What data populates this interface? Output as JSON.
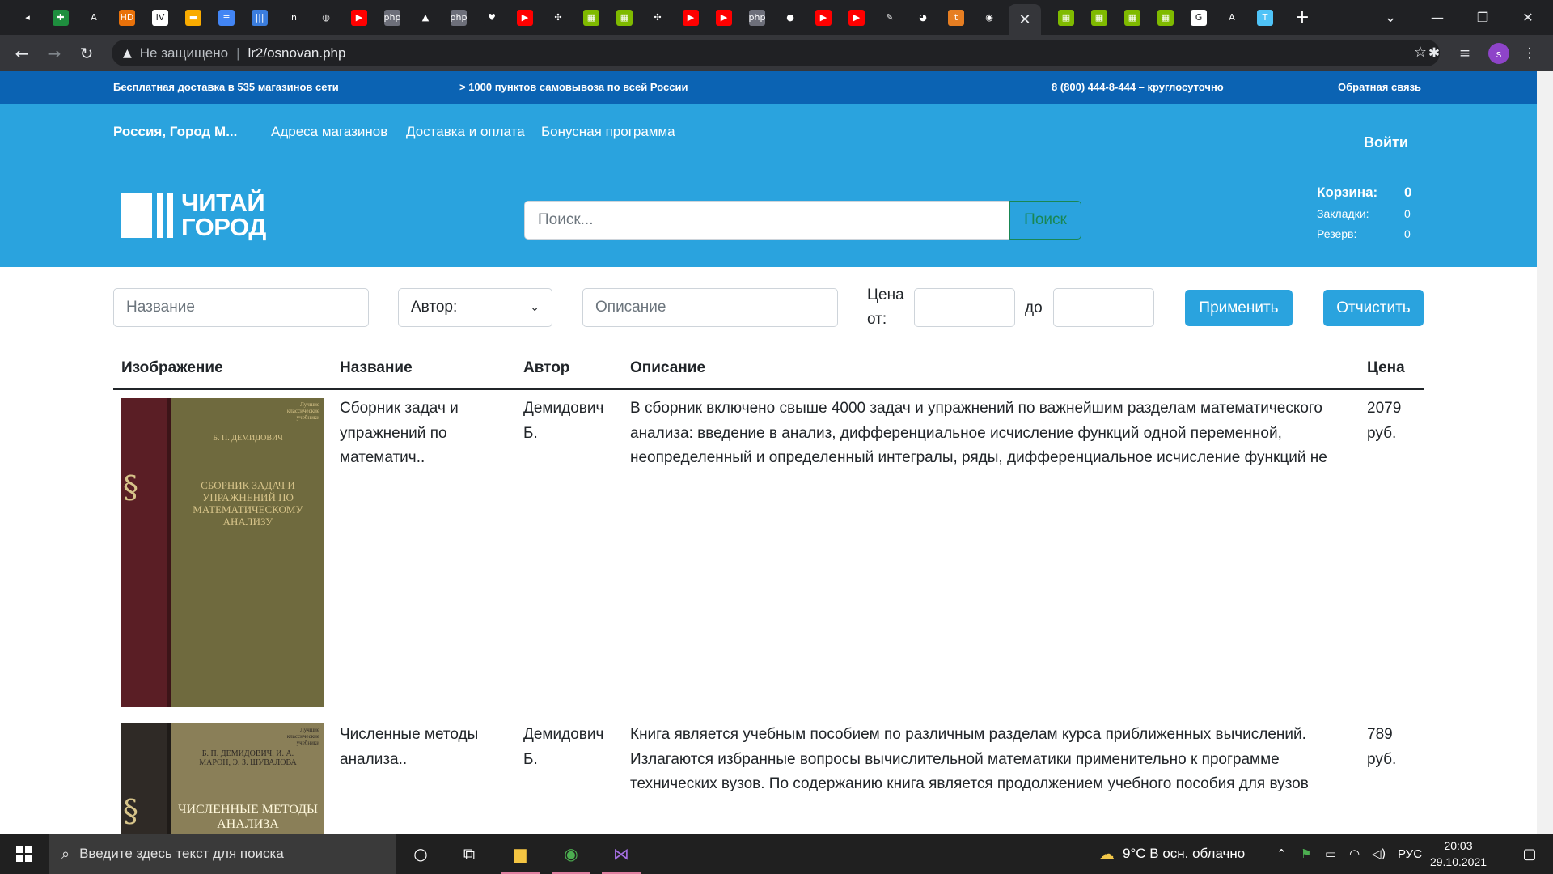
{
  "browser": {
    "tabs": [
      {
        "icon": "speaker-icon",
        "glyph": "◂",
        "color": "#202124"
      },
      {
        "icon": "sheets-icon",
        "glyph": "✚",
        "color": "#1e8e3e"
      },
      {
        "icon": "pdf-icon",
        "glyph": "A",
        "color": "#202124"
      },
      {
        "icon": "hd-icon",
        "glyph": "HD",
        "color": "#e8710a"
      },
      {
        "icon": "iv-icon",
        "glyph": "IV",
        "color": "#ffffff"
      },
      {
        "icon": "slides-icon",
        "glyph": "▬",
        "color": "#f9ab00"
      },
      {
        "icon": "docs-icon",
        "glyph": "≡",
        "color": "#4285f4"
      },
      {
        "icon": "library-icon",
        "glyph": "|||",
        "color": "#3b7ddd"
      },
      {
        "icon": "in-icon",
        "glyph": "in",
        "color": "#202124"
      },
      {
        "icon": "globe-icon",
        "glyph": "◍",
        "color": "#202124"
      },
      {
        "icon": "youtube-icon",
        "glyph": "▶",
        "color": "#ff0000"
      },
      {
        "icon": "php-icon",
        "glyph": "php",
        "color": "#6d6f7a"
      },
      {
        "icon": "mountain-icon",
        "glyph": "▲",
        "color": "#202124"
      },
      {
        "icon": "php-icon",
        "glyph": "php",
        "color": "#6d6f7a"
      },
      {
        "icon": "heart-icon",
        "glyph": "♥",
        "color": "#202124"
      },
      {
        "icon": "youtube-icon",
        "glyph": "▶",
        "color": "#ff0000"
      },
      {
        "icon": "network-icon",
        "glyph": "✣",
        "color": "#202124"
      },
      {
        "icon": "microsoft-icon",
        "glyph": "▦",
        "color": "#7fba00"
      },
      {
        "icon": "microsoft-icon",
        "glyph": "▦",
        "color": "#7fba00"
      },
      {
        "icon": "network-icon",
        "glyph": "✣",
        "color": "#202124"
      },
      {
        "icon": "youtube-icon",
        "glyph": "▶",
        "color": "#ff0000"
      },
      {
        "icon": "youtube-icon",
        "glyph": "▶",
        "color": "#ff0000"
      },
      {
        "icon": "php-icon",
        "glyph": "php",
        "color": "#6d6f7a"
      },
      {
        "icon": "drop-icon",
        "glyph": "●",
        "color": "#202124"
      },
      {
        "icon": "youtube-icon",
        "glyph": "▶",
        "color": "#ff0000"
      },
      {
        "icon": "youtube-icon",
        "glyph": "▶",
        "color": "#ff0000"
      },
      {
        "icon": "pen-icon",
        "glyph": "✎",
        "color": "#202124"
      },
      {
        "icon": "avatar-icon",
        "glyph": "◕",
        "color": "#202124"
      },
      {
        "icon": "orange-circle-icon",
        "glyph": "t",
        "color": "#e67e22"
      },
      {
        "icon": "github-icon",
        "glyph": "◉",
        "color": "#202124"
      }
    ],
    "active_tab_close": "✕",
    "tabs_after": [
      {
        "icon": "microsoft-icon",
        "glyph": "▦",
        "color": "#7fba00"
      },
      {
        "icon": "microsoft-icon",
        "glyph": "▦",
        "color": "#7fba00"
      },
      {
        "icon": "microsoft-icon",
        "glyph": "▦",
        "color": "#7fba00"
      },
      {
        "icon": "microsoft-icon",
        "glyph": "▦",
        "color": "#7fba00"
      },
      {
        "icon": "google-icon",
        "glyph": "G",
        "color": "#ffffff"
      },
      {
        "icon": "translate-icon",
        "glyph": "A",
        "color": "#202124"
      },
      {
        "icon": "t-icon",
        "glyph": "T",
        "color": "#4fc3f7"
      }
    ],
    "new_tab": "+",
    "security_label": "Не защищено",
    "url": "lr2/osnovan.php",
    "profile_initial": "s"
  },
  "site": {
    "top_bar": {
      "delivery": "Бесплатная доставка в 535 магазинов сети",
      "pickup": "> 1000 пунктов самовывоза по всей России",
      "phone": "8 (800) 444-8-444 – круглосуточно",
      "feedback": "Обратная связь"
    },
    "nav": {
      "city": "Россия, Город М...",
      "stores": "Адреса магазинов",
      "delivery": "Доставка и оплата",
      "bonus": "Бонусная программа",
      "login": "Войти"
    },
    "logo": {
      "line1": "ЧИТАЙ",
      "line2": "ГОРОД"
    },
    "search": {
      "placeholder": "Поиск...",
      "button": "Поиск"
    },
    "cart": {
      "cart_label": "Корзина:",
      "cart_count": "0",
      "bookmarks_label": "Закладки:",
      "bookmarks_count": "0",
      "reserve_label": "Резерв:",
      "reserve_count": "0"
    }
  },
  "filters": {
    "name_placeholder": "Название",
    "author_selected": "Автор:",
    "description_placeholder": "Описание",
    "price_from_label_1": "Цена",
    "price_from_label_2": "от:",
    "price_to_label": "до",
    "apply_button": "Применить",
    "clear_button": "Отчистить"
  },
  "table": {
    "headers": {
      "image": "Изображение",
      "name": "Название",
      "author": "Автор",
      "description": "Описание",
      "price": "Цена"
    },
    "rows": [
      {
        "name": "Сборник задач и упражнений по математич..",
        "author": "Демидович Б.",
        "description": "В сборник включено свыше 4000 задач и упражнений по важнейшим разделам математического анализа: введение в анализ, дифференциальное исчисление функций одной переменной, неопределенный и определенный интегралы, ряды, дифференциальное исчисление функций не",
        "price": "2079 руб.",
        "cover": {
          "series": "Лучшие классические учебники",
          "author": "Б. П. ДЕМИДОВИЧ",
          "title": "Сборник задач и упражнений по математическому анализу"
        }
      },
      {
        "name": "Численные методы анализа..",
        "author": "Демидович Б.",
        "description": "Книга является учебным пособием по различным разделам курса приближенных вычислений. Излагаются избранные вопросы вычислительной математики применительно к программе технических вузов. По содержанию книга является продолжением учебного пособия для вузов",
        "price": "789 руб.",
        "cover": {
          "series": "Лучшие классические учебники",
          "author": "Б. П. ДЕМИДОВИЧ, И. А. МАРОН, Э. З. ШУВАЛОВА",
          "title": "Численные методы анализа"
        }
      }
    ]
  },
  "taskbar": {
    "search_placeholder": "Введите здесь текст для поиска",
    "weather": "9°C  В осн. облачно",
    "language": "РУС",
    "time": "20:03",
    "date": "29.10.2021"
  },
  "colors": {
    "top_strip": "#0b63b3",
    "header": "#2aa3de",
    "accent_button": "#2aa3de",
    "search_border": "#198754"
  }
}
